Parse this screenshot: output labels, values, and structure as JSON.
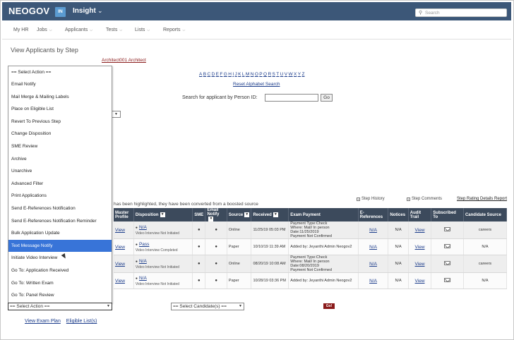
{
  "header": {
    "logo": "NEOGOV",
    "badge": "IN",
    "product": "Insight",
    "search_placeholder": "Search"
  },
  "nav": [
    {
      "label": "My HR",
      "has_menu": false
    },
    {
      "label": "Jobs",
      "has_menu": true
    },
    {
      "label": "Applicants",
      "has_menu": true
    },
    {
      "label": "Tests",
      "has_menu": true
    },
    {
      "label": "Lists",
      "has_menu": true
    },
    {
      "label": "Reports",
      "has_menu": true
    }
  ],
  "page": {
    "title": "View Applicants by Step",
    "architect_link": "Architect001 Architect",
    "alphabet": [
      "A",
      "B",
      "C",
      "D",
      "E",
      "F",
      "G",
      "H",
      "I",
      "J",
      "K",
      "L",
      "M",
      "N",
      "O",
      "P",
      "Q",
      "R",
      "S",
      "T",
      "U",
      "V",
      "W",
      "X",
      "Y",
      "Z"
    ],
    "reset_link": "Reset Alphabet Search",
    "person_id_label": "Search for applicant by Person ID:",
    "go_label": "Go",
    "highlight_note": "has been highlighted, they have been converted from a boosted source",
    "step_history": "Step History",
    "step_comments": "Step Comments",
    "step_rating_link": "Step Rating Details Report"
  },
  "table": {
    "headers": [
      "Master Profile",
      "Disposition",
      "SME",
      "Email Notify",
      "Source",
      "Received",
      "Exam Payment",
      "E-References",
      "Notices",
      "Audit Trail",
      "Subscribed To",
      "Candidate Source"
    ],
    "rows": [
      {
        "view": "View",
        "disposition": "N/A",
        "disp_sub": "Video Interview Not Initiated",
        "sme": "●",
        "email": "●",
        "source": "Online",
        "received": "11/25/19 05:03 PM",
        "payment": [
          "Payment Type:Check",
          "Where: Mail/ In person",
          "Date:11/25/2019",
          "Payment Not Confirmed"
        ],
        "eref": "N/A",
        "notices": "N/A",
        "audit": "View",
        "candidate_source": "careers"
      },
      {
        "view": "View",
        "disposition": "Pass",
        "disp_sub": "Video Interview Completed",
        "sme": "●",
        "email": "●",
        "source": "Paper",
        "received": "10/10/19 11:39 AM",
        "payment": [
          "Added by: Jeyanthi Admin Neogov2"
        ],
        "eref": "N/A",
        "notices": "N/A",
        "audit": "View",
        "candidate_source": "N/A"
      },
      {
        "view": "View",
        "disposition": "N/A",
        "disp_sub": "Video Interview Not Initiated",
        "sme": "●",
        "email": "●",
        "source": "Online",
        "received": "08/20/19 10:08 AM",
        "payment": [
          "Payment Type:Check",
          "Where: Mail/ In person",
          "Date:08/20/2019",
          "Payment Not Confirmed"
        ],
        "eref": "N/A",
        "notices": "N/A",
        "audit": "View",
        "candidate_source": "careers"
      },
      {
        "view": "View",
        "disposition": "N/A",
        "disp_sub": "Video Interview Not Initiated",
        "sme": "●",
        "email": "●",
        "source": "Paper",
        "received": "10/28/19 03:36 PM",
        "payment": [
          "Added by: Jeyanthi Admin Neogov2"
        ],
        "eref": "N/A",
        "notices": "N/A",
        "audit": "View",
        "candidate_source": "N/A"
      }
    ]
  },
  "action_dropdown": {
    "options": [
      "== Select Action ==",
      "Email Notify",
      "Mail Merge & Mailing Labels",
      "Place on Eligible List",
      "Revert To Previous Step",
      "Change Disposition",
      "SME Review",
      "Archive",
      "Unarchive",
      "Advanced Filter",
      "Print Applications",
      "Send E-References Notification",
      "Send E-References Notification Reminder",
      "Bulk Application Update",
      "Text Message Notify",
      "Initiate Video Interview",
      "Go To: Application Received",
      "Go To: Written Exam",
      "Go To: Panel Review"
    ],
    "highlighted": "Text Message Notify",
    "selected_value": "== Select Action =="
  },
  "candidate_select": "== Select Candidate(s) ==",
  "go_small": "Go!",
  "bottom_links": [
    "View Exam Plan",
    "Eligible List(s)"
  ]
}
